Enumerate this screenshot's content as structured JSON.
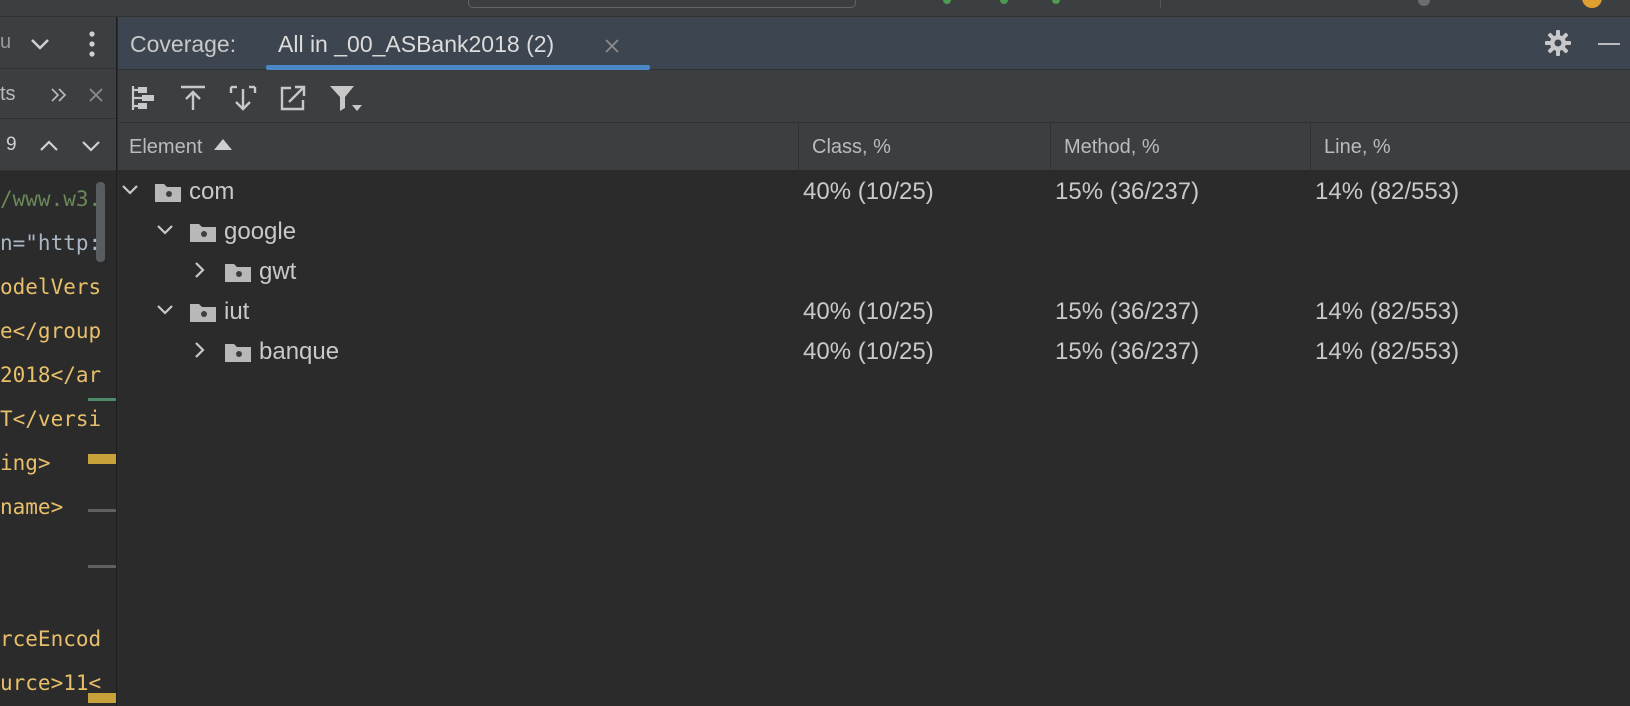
{
  "left_panel": {
    "header_text": "u",
    "tabs_text": "ts",
    "find_count": "9",
    "code_lines": [
      "/www.w3.",
      "n=\"http:",
      "odelVers",
      "e</group",
      "2018</ar",
      "T</versi",
      "ing>",
      "name>",
      "",
      "",
      "rceEncod",
      "urce>11<"
    ]
  },
  "coverage": {
    "title": "Coverage:",
    "tab_label": "All in _00_ASBank2018 (2)",
    "toolbar": {
      "icons": [
        "flatten-packages-icon",
        "navigate-up-icon",
        "navigate-down-icon",
        "export-icon",
        "filter-icon"
      ]
    },
    "columns": {
      "element": "Element",
      "class": "Class, %",
      "method": "Method, %",
      "line": "Line, %"
    },
    "rows": [
      {
        "name": "com",
        "depth": 0,
        "state": "expanded",
        "class": "40% (10/25)",
        "method": "15% (36/237)",
        "line": "14% (82/553)"
      },
      {
        "name": "google",
        "depth": 1,
        "state": "expanded",
        "class": "",
        "method": "",
        "line": ""
      },
      {
        "name": "gwt",
        "depth": 2,
        "state": "collapsed",
        "class": "",
        "method": "",
        "line": ""
      },
      {
        "name": "iut",
        "depth": 1,
        "state": "expanded",
        "class": "40% (10/25)",
        "method": "15% (36/237)",
        "line": "14% (82/553)"
      },
      {
        "name": "banque",
        "depth": 2,
        "state": "collapsed",
        "class": "40% (10/25)",
        "method": "15% (36/237)",
        "line": "14% (82/553)"
      }
    ]
  },
  "colors": {
    "accent": "#4a88c7",
    "header_bg": "#3d4550",
    "panel_bg": "#2b2b2b",
    "toolbar_bg": "#3c3f41"
  }
}
